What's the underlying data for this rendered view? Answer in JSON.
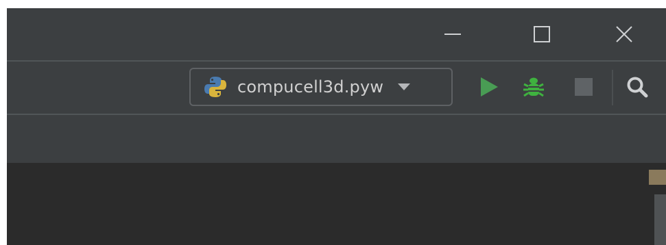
{
  "window": {
    "controls": {
      "minimize_icon": "minimize-icon",
      "maximize_icon": "maximize-icon",
      "close_icon": "close-icon"
    }
  },
  "toolbar": {
    "run_configuration": {
      "label": "compucell3d.pyw",
      "icon": "python-icon",
      "dropdown_icon": "chevron-down-icon"
    },
    "actions": [
      {
        "name": "run",
        "icon": "play-icon",
        "color": "#499c54"
      },
      {
        "name": "debug",
        "icon": "bug-icon",
        "color": "#3fb23f"
      },
      {
        "name": "stop",
        "icon": "stop-icon",
        "color": "#5f6366"
      },
      {
        "name": "search",
        "icon": "search-icon",
        "color": "#cfd1d3"
      }
    ]
  },
  "colors": {
    "chrome_background": "#3c3f41",
    "editor_background": "#2b2b2b",
    "text": "#d0d0d0",
    "border": "#5e6164"
  }
}
